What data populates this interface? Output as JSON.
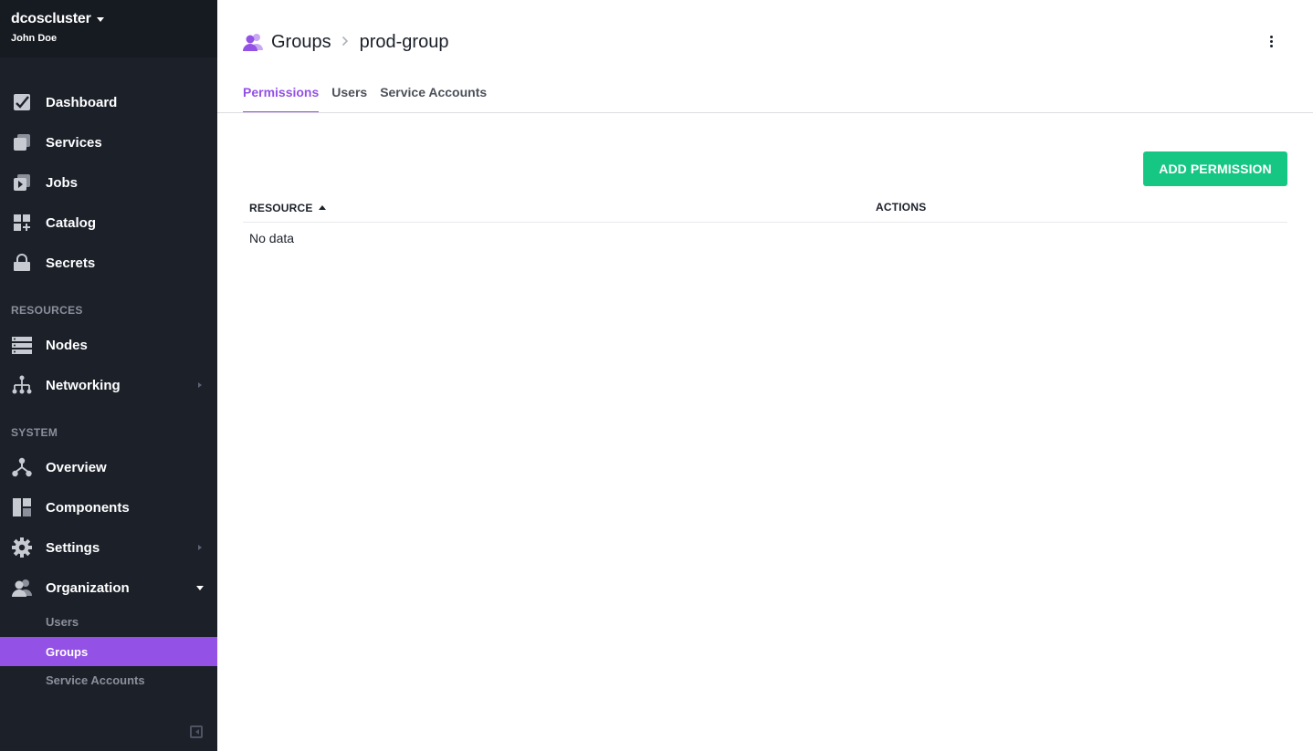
{
  "sidebar": {
    "cluster_name": "dcoscluster",
    "user_name": "John Doe",
    "items": [
      {
        "label": "Dashboard",
        "icon": "dashboard-icon"
      },
      {
        "label": "Services",
        "icon": "services-icon"
      },
      {
        "label": "Jobs",
        "icon": "jobs-icon"
      },
      {
        "label": "Catalog",
        "icon": "catalog-icon"
      },
      {
        "label": "Secrets",
        "icon": "secrets-icon"
      }
    ],
    "resources_heading": "RESOURCES",
    "resources": [
      {
        "label": "Nodes",
        "icon": "nodes-icon"
      },
      {
        "label": "Networking",
        "icon": "networking-icon"
      }
    ],
    "system_heading": "SYSTEM",
    "system": [
      {
        "label": "Overview",
        "icon": "overview-icon"
      },
      {
        "label": "Components",
        "icon": "components-icon"
      },
      {
        "label": "Settings",
        "icon": "gear-icon"
      },
      {
        "label": "Organization",
        "icon": "organization-icon"
      }
    ],
    "organization_subitems": [
      {
        "label": "Users"
      },
      {
        "label": "Groups",
        "active": true
      },
      {
        "label": "Service Accounts"
      }
    ],
    "colors": {
      "background": "#1b2029",
      "active": "#9351e5"
    }
  },
  "header": {
    "breadcrumb_root": "Groups",
    "breadcrumb_current": "prod-group"
  },
  "tabs": [
    {
      "label": "Permissions",
      "active": true
    },
    {
      "label": "Users"
    },
    {
      "label": "Service Accounts"
    }
  ],
  "toolbar": {
    "add_permission_label": "ADD PERMISSION",
    "accent": "#16c784"
  },
  "table": {
    "columns": [
      {
        "label": "RESOURCE",
        "sorted": "asc"
      },
      {
        "label": "ACTIONS"
      }
    ],
    "empty_text": "No data"
  }
}
